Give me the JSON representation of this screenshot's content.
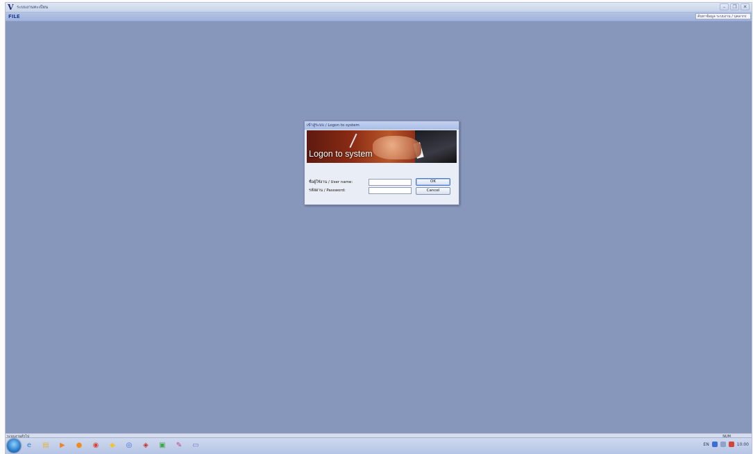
{
  "app": {
    "logo": "V",
    "title": "ระบบงานทะเบียน",
    "window_controls": [
      "–",
      "❐",
      "✕"
    ]
  },
  "menu": {
    "file_label": "FILE",
    "search_text": "ค้นหาข้อมูล ระบบงาน / บุคลากร"
  },
  "status": {
    "left_text": "ระบบงานทั่วไป",
    "num_indicator": "NUM"
  },
  "dialog": {
    "title": "เข้าสู่ระบบ / Logon to system",
    "banner_text": "Logon to system",
    "username_label": "ชื่อผู้ใช้งาน / User name:",
    "username_value": "",
    "password_label": "รหัสผ่าน / Password:",
    "password_value": "",
    "ok_label": "OK",
    "cancel_label": "Cancel"
  },
  "taskbar": {
    "icons": [
      {
        "name": "ie-icon",
        "glyph": "e",
        "color": "#2a7cd0"
      },
      {
        "name": "explorer-icon",
        "glyph": "▤",
        "color": "#e2b43a"
      },
      {
        "name": "media-player-icon",
        "glyph": "▶",
        "color": "#e8862a"
      },
      {
        "name": "app-orange-icon",
        "glyph": "●",
        "color": "#f08c1c"
      },
      {
        "name": "chrome-icon",
        "glyph": "◉",
        "color": "#d9432f"
      },
      {
        "name": "app-yellow-icon",
        "glyph": "◆",
        "color": "#f2c230"
      },
      {
        "name": "app-blue-icon",
        "glyph": "◎",
        "color": "#3b6fd6"
      },
      {
        "name": "app-red-icon",
        "glyph": "◈",
        "color": "#c8302a"
      },
      {
        "name": "app-green-icon",
        "glyph": "▣",
        "color": "#3da84a"
      },
      {
        "name": "app-pink-icon",
        "glyph": "✎",
        "color": "#c23b8c"
      },
      {
        "name": "app-window-icon",
        "glyph": "▭",
        "color": "#6a7fb8"
      }
    ],
    "tray_text": "EN",
    "clock": "10:00"
  }
}
